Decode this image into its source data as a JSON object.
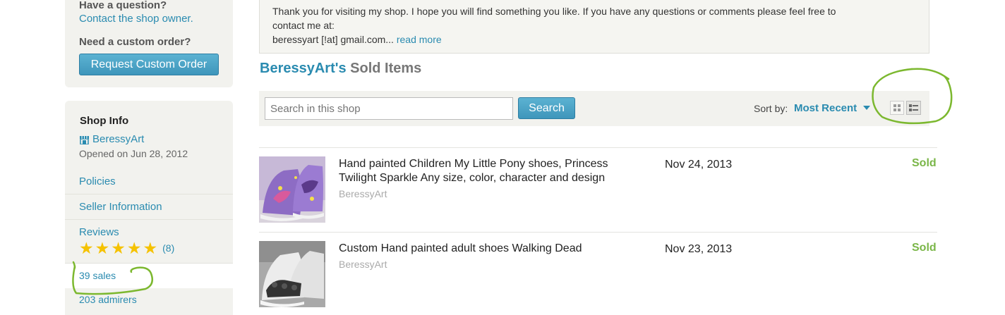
{
  "sidebar": {
    "question_title": "Have a question?",
    "contact_link": "Contact the shop owner.",
    "custom_title": "Need a custom order?",
    "custom_button": "Request Custom Order",
    "info_title": "Shop Info",
    "shop_name": "BeressyArt",
    "opened": "Opened on Jun 28, 2012",
    "links": {
      "policies": "Policies",
      "seller_info": "Seller Information",
      "reviews": "Reviews"
    },
    "rating_stars": 5,
    "review_count": "(8)",
    "sales": "39 sales",
    "admirers": "203 admirers"
  },
  "announcement": {
    "line1": "Thank you for visiting my shop. I hope you will find something you like. If you have any questions or comments please feel free to",
    "line2": "contact me at:",
    "line3": "beressyart [!at] gmail.com...",
    "read_more": "read more"
  },
  "heading": {
    "shop": "BeressyArt's",
    "rest": "Sold Items"
  },
  "toolbar": {
    "search_placeholder": "Search in this shop",
    "search_button": "Search",
    "sort_label": "Sort by:",
    "sort_value": "Most Recent"
  },
  "items": [
    {
      "title": "Hand painted Children My Little Pony shoes, Princess Twilight Sparkle Any size, color, character and design",
      "shop": "BeressyArt",
      "date": "Nov 24, 2013",
      "status": "Sold"
    },
    {
      "title": "Custom Hand painted adult shoes Walking Dead",
      "shop": "BeressyArt",
      "date": "Nov 23, 2013",
      "status": "Sold"
    }
  ],
  "colors": {
    "link": "#2a8bb0",
    "sold": "#7ab648",
    "annotation": "#7cb82f",
    "star": "#f5c200"
  }
}
